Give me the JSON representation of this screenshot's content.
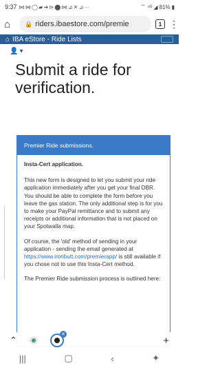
{
  "status_bar": {
    "time": "9:37",
    "icons": "⋈ ⋈ ◯ ▰ ➜ ⊳ ⬤ ⋈ ⊿ ✕ ⊿ ···",
    "network": "⁴ᴳ",
    "battery": "81%"
  },
  "browser": {
    "url": "riders.ibaestore.com/premie",
    "tab_count": "1"
  },
  "site_nav": {
    "brand": "IBA eStore - Ride Lists"
  },
  "page": {
    "title": "Submit a ride for verification."
  },
  "panel": {
    "heading": "Premier Ride submissions.",
    "subheading": "Insta-Cert application.",
    "para1": "This new form is designed to let you submit your ride application immediately after you get your final DBR. You should be able to complete the form before you leave the gas station. The only additional step is for you to make your PayPal remittance and to submit any receipts or additional information that is not placed on your Spotwalla map.",
    "para2_before": "Of course, the 'old' method of sending in your application - sending the email generated at ",
    "para2_link": "https://www.ironbutt.com/premierapp/",
    "para2_after": " is still available if you chose not to use this Insta-Cert method.",
    "para3": "The Premier Ride submission process is outlined here:"
  }
}
